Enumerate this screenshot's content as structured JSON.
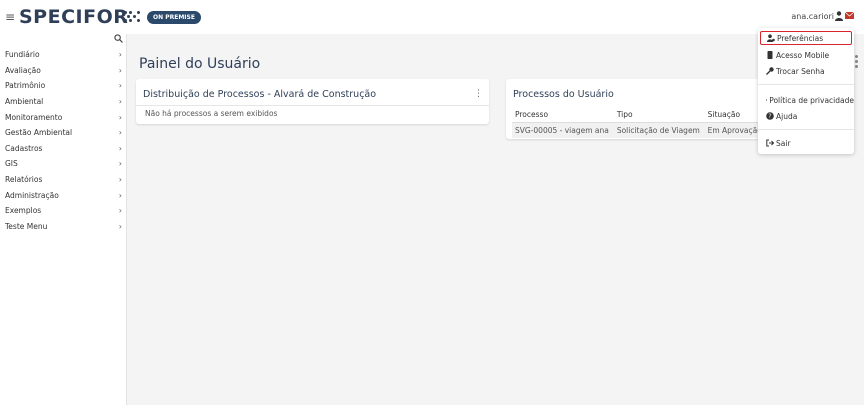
{
  "header": {
    "menu_icon": "hamburger-icon",
    "logo_text": "SPECIFOR",
    "badge": "ON PREMISE",
    "user_name": "ana.cariori",
    "user_icon": "user-icon",
    "mail_icon": "envelope-icon"
  },
  "sidebar": {
    "search_icon": "search-icon",
    "items": [
      {
        "label": "Fundiário"
      },
      {
        "label": "Avaliação"
      },
      {
        "label": "Patrimônio"
      },
      {
        "label": "Ambiental"
      },
      {
        "label": "Monitoramento"
      },
      {
        "label": "Gestão Ambiental"
      },
      {
        "label": "Cadastros"
      },
      {
        "label": "GIS"
      },
      {
        "label": "Relatórios"
      },
      {
        "label": "Administração"
      },
      {
        "label": "Exemplos"
      },
      {
        "label": "Teste Menu"
      }
    ],
    "chevron": "›"
  },
  "main": {
    "title": "Painel do Usuário",
    "card_distribution": {
      "title": "Distribuição de Processos - Alvará de Construção",
      "menu": "⋮",
      "empty": "Não há processos a serem exibidos"
    },
    "card_processes": {
      "title": "Processos do Usuário",
      "columns": [
        "Processo",
        "Tipo",
        "Situação"
      ],
      "rows": [
        [
          "SVG-00005 - viagem ana",
          "Solicitação de Viagem",
          "Em Aprovação"
        ]
      ]
    }
  },
  "dropdown": {
    "items": [
      {
        "label": "Preferências",
        "icon": "user-cog-icon"
      },
      {
        "label": "Acesso Mobile",
        "icon": "mobile-icon"
      },
      {
        "label": "Trocar Senha",
        "icon": "key-icon"
      },
      {
        "label": "Política de privacidade",
        "icon": "document-icon"
      },
      {
        "label": "Ajuda",
        "icon": "question-icon"
      },
      {
        "label": "Sair",
        "icon": "sign-out-icon"
      }
    ]
  },
  "colors": {
    "brand": "#2f3f58",
    "badge": "#2b4a6b",
    "highlight": "#d9232d",
    "background": "#f4f4f4"
  }
}
